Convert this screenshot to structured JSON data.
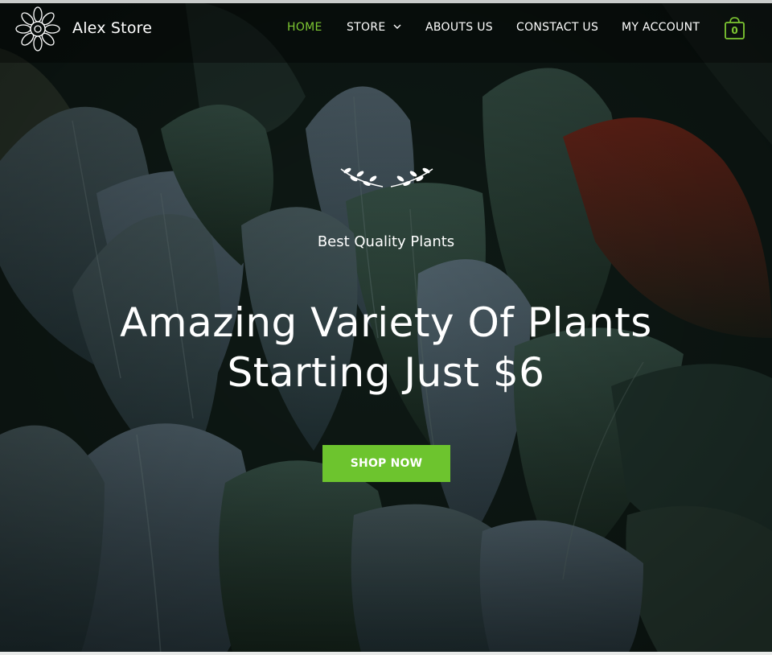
{
  "header": {
    "brand": "Alex Store",
    "cart_count": "0"
  },
  "nav": {
    "home": "HOME",
    "store": "STORE",
    "about": "ABOUTS US",
    "contact": "CONSTACT US",
    "account": "MY ACCOUNT"
  },
  "hero": {
    "subtitle": "Best Quality Plants",
    "headline": "Amazing Variety Of Plants Starting Just $6",
    "cta_label": "SHOP NOW"
  },
  "colors": {
    "accent": "#6dc42e",
    "active_nav": "#7ec832"
  },
  "icons": {
    "logo": "flower-logo-icon",
    "store_dropdown": "chevron-down-icon",
    "cart": "shopping-bag-icon",
    "ornament": "laurel-branches-icon"
  }
}
